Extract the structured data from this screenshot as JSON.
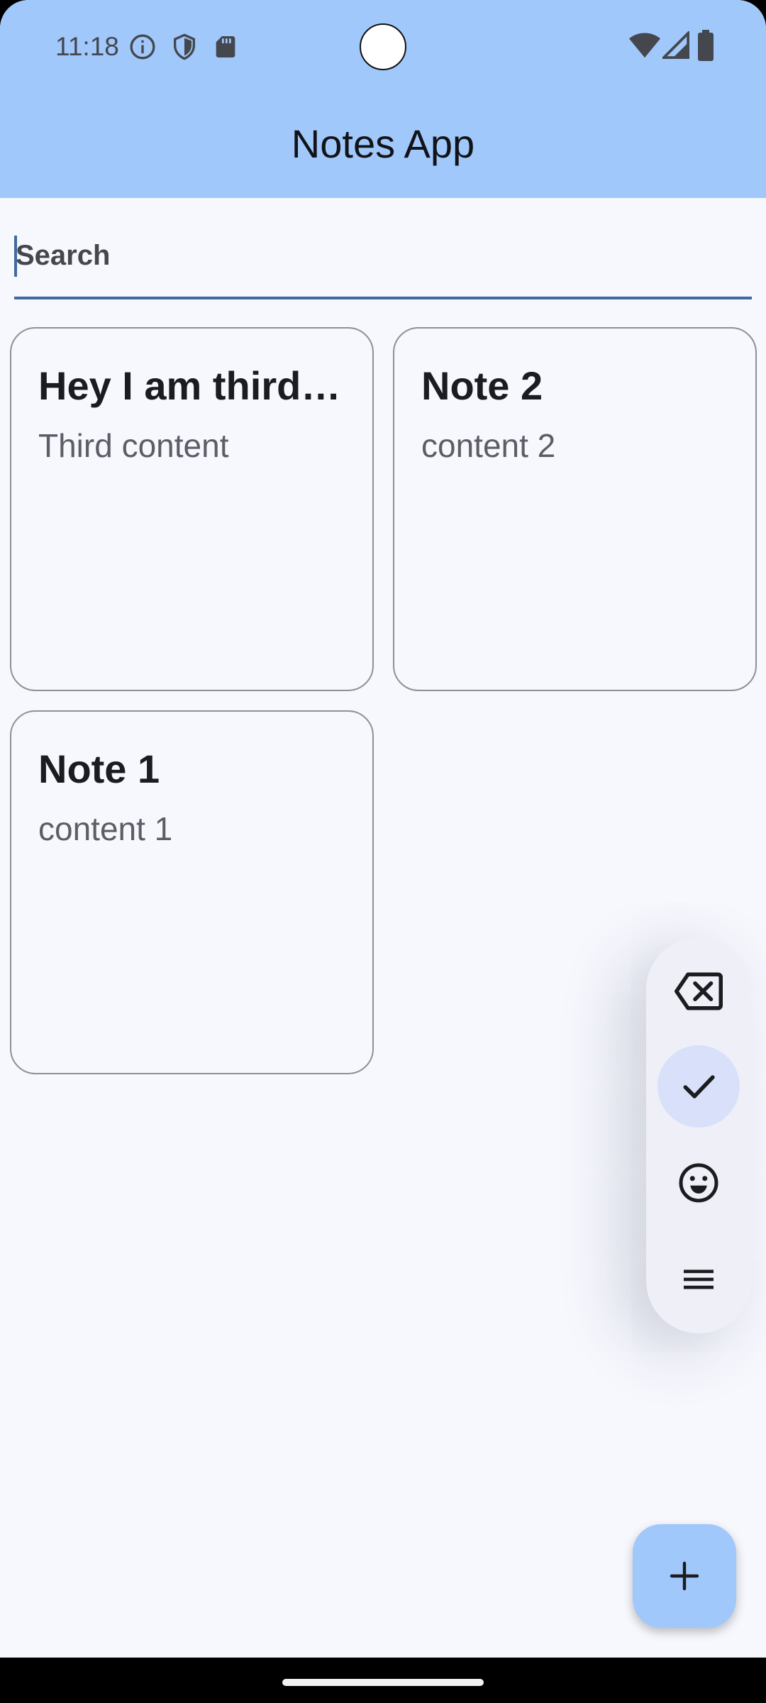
{
  "status_bar": {
    "time": "11:18",
    "left_icons": [
      "info-icon",
      "shield-icon",
      "sd-card-icon"
    ],
    "right_icons": [
      "wifi-icon",
      "signal-icon",
      "battery-icon"
    ]
  },
  "app_bar": {
    "title": "Notes App",
    "color": "#a1c8fa"
  },
  "search": {
    "placeholder": "Search",
    "value": ""
  },
  "notes": [
    {
      "title": "Hey I am third note",
      "content": "Third content"
    },
    {
      "title": "Note 2",
      "content": "content 2"
    },
    {
      "title": "Note 1",
      "content": "content 1"
    }
  ],
  "side_toolbar": {
    "buttons": [
      {
        "icon": "backspace-icon",
        "selected": false
      },
      {
        "icon": "check-icon",
        "selected": true
      },
      {
        "icon": "emoji-icon",
        "selected": false
      },
      {
        "icon": "menu-icon",
        "selected": false
      }
    ]
  },
  "fab": {
    "icon": "add-icon"
  },
  "colors": {
    "background": "#f7f8fe",
    "accent": "#3e6aa0",
    "selected_tool": "#d9e1fa"
  }
}
